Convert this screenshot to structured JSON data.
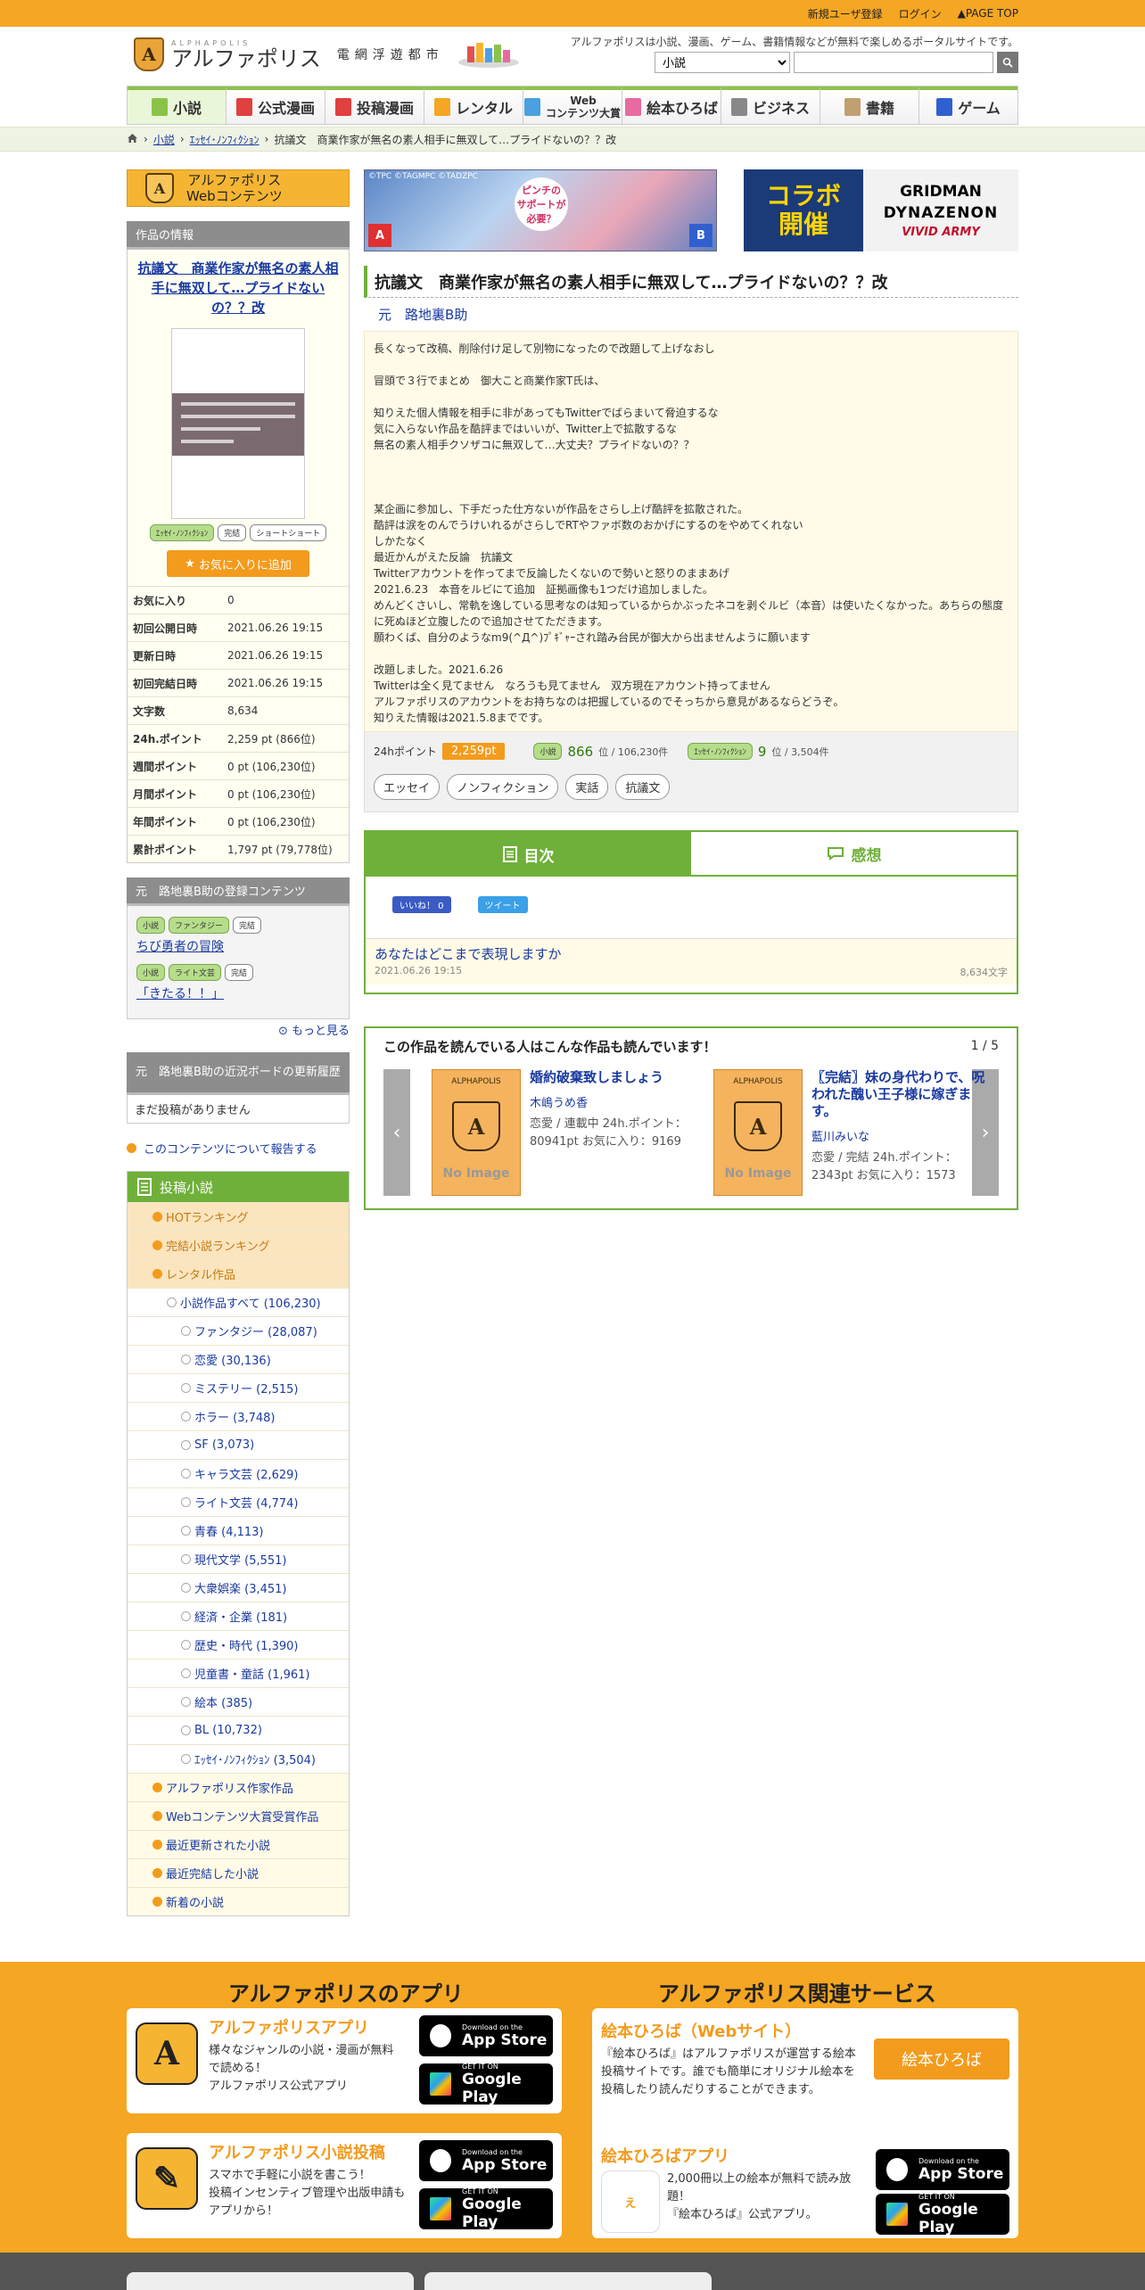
{
  "topbar": {
    "register": "新規ユーザ登録",
    "login": "ログイン",
    "pagetop": "PAGE TOP"
  },
  "header": {
    "logo_small": "ALPHAPOLIS",
    "logo_main": "アルファポリス",
    "logo_sub": "電網浮遊都市",
    "tagline": "アルファポリスは小説、漫画、ゲーム、書籍情報などが無料で楽しめるポータルサイトです。",
    "search_category": "小説"
  },
  "nav": [
    {
      "label": "小説",
      "color": "#8bc34a"
    },
    {
      "label": "公式漫画",
      "color": "#e04040"
    },
    {
      "label": "投稿漫画",
      "color": "#e04040"
    },
    {
      "label": "レンタル",
      "color": "#f5a623"
    },
    {
      "label": "Web\nコンテンツ大賞",
      "color": "#4aa0e0"
    },
    {
      "label": "絵本ひろば",
      "color": "#e86aa0"
    },
    {
      "label": "ビジネス",
      "color": "#888888"
    },
    {
      "label": "書籍",
      "color": "#c0a070"
    },
    {
      "label": "ゲーム",
      "color": "#3060d0"
    }
  ],
  "breadcrumb": {
    "c1": "小説",
    "c2": "ｴｯｾｲ･ﾉﾝﾌｨｸｼｮﾝ",
    "c3": "抗議文　商業作家が無名の素人相手に無双して…プライドないの？？改"
  },
  "side": {
    "webcontents_line1": "アルファポリス",
    "webcontents_line2": "Webコンテンツ",
    "info_header": "作品の情報",
    "title": "抗議文　商業作家が無名の素人相手に無双して…プライドないの？？改",
    "tags": [
      "ｴｯｾｲ･ﾉﾝﾌｨｸｼｮﾝ",
      "完結",
      "ショートショート"
    ],
    "fav_button": "お気に入りに追加",
    "stats": [
      {
        "k": "お気に入り",
        "v": "0"
      },
      {
        "k": "初回公開日時",
        "v": "2021.06.26 19:15"
      },
      {
        "k": "更新日時",
        "v": "2021.06.26 19:15"
      },
      {
        "k": "初回完結日時",
        "v": "2021.06.26 19:15"
      },
      {
        "k": "文字数",
        "v": "8,634"
      },
      {
        "k": "24h.ポイント",
        "v": "2,259 pt (866位)"
      },
      {
        "k": "週間ポイント",
        "v": "0 pt (106,230位)"
      },
      {
        "k": "月間ポイント",
        "v": "0 pt (106,230位)"
      },
      {
        "k": "年間ポイント",
        "v": "0 pt (106,230位)"
      },
      {
        "k": "累計ポイント",
        "v": "1,797 pt (79,778位)"
      }
    ],
    "reg_header": "元　路地裏B助の登録コンテンツ",
    "reg_items": [
      {
        "tags": [
          "小説",
          "ファンタジー",
          "完結"
        ],
        "title": "ちび勇者の冒険"
      },
      {
        "tags": [
          "小説",
          "ライト文芸",
          "完結"
        ],
        "title": "「きたる！！」"
      }
    ],
    "more": "もっと見る",
    "board_header": "元　路地裏B助の近況ボードの更新履歴",
    "board_none": "まだ投稿がありません",
    "report": "このコンテンツについて報告する",
    "menu_header": "投稿小説",
    "menu": [
      {
        "label": "HOTランキング",
        "cls": "orange"
      },
      {
        "label": "完結小説ランキング",
        "cls": "orange"
      },
      {
        "label": "レンタル作品",
        "cls": "orange"
      },
      {
        "label": "小説作品すべて (106,230)",
        "cls": "sub"
      },
      {
        "label": "ファンタジー (28,087)",
        "cls": "sub2"
      },
      {
        "label": "恋愛 (30,136)",
        "cls": "sub2"
      },
      {
        "label": "ミステリー (2,515)",
        "cls": "sub2"
      },
      {
        "label": "ホラー (3,748)",
        "cls": "sub2"
      },
      {
        "label": "SF (3,073)",
        "cls": "sub2"
      },
      {
        "label": "キャラ文芸 (2,629)",
        "cls": "sub2"
      },
      {
        "label": "ライト文芸 (4,774)",
        "cls": "sub2"
      },
      {
        "label": "青春 (4,113)",
        "cls": "sub2"
      },
      {
        "label": "現代文学 (5,551)",
        "cls": "sub2"
      },
      {
        "label": "大衆娯楽 (3,451)",
        "cls": "sub2"
      },
      {
        "label": "経済・企業 (181)",
        "cls": "sub2"
      },
      {
        "label": "歴史・時代 (1,390)",
        "cls": "sub2"
      },
      {
        "label": "児童書・童話 (1,961)",
        "cls": "sub2"
      },
      {
        "label": "絵本 (385)",
        "cls": "sub2"
      },
      {
        "label": "BL (10,732)",
        "cls": "sub2"
      },
      {
        "label": "ｴｯｾｲ･ﾉﾝﾌｨｸｼｮﾝ (3,504)",
        "cls": "sub2"
      },
      {
        "label": "アルファポリス作家作品",
        "cls": "yl"
      },
      {
        "label": "Webコンテンツ大賞受賞作品",
        "cls": "yl"
      },
      {
        "label": "最近更新された小説",
        "cls": "yl"
      },
      {
        "label": "最近完結した小説",
        "cls": "yl"
      },
      {
        "label": "新着の小説",
        "cls": "yl"
      }
    ]
  },
  "banner": {
    "copy": "©TPC ©TAGMPC ©TADZPC",
    "bubble": "ピンチの\nサポートが\n必要？",
    "collab": "コラボ\n開催",
    "g1": "GRIDMAN",
    "g2": "DYNAZENON",
    "g3": "VIVID ARMY"
  },
  "work": {
    "title": "抗議文　商業作家が無名の素人相手に無双して…プライドないの？？改",
    "author": "元　路地裏B助",
    "description": "長くなって改稿、削除付け足して別物になったので改題して上げなおし\n\n冒頭で３行でまとめ　御大こと商業作家T氏は、\n\n知りえた個人情報を相手に非があってもTwitterでばらまいて脅迫するな\n気に入らない作品を酷評まではいいが、Twitter上で拡散するな\n無名の素人相手クソザコに無双して…大丈夫？プライドないの？？\n\n\n\n某企画に参加し、下手だった仕方ないが作品をさらし上げ酷評を拡散された。\n酷評は涙をのんでうけいれるがさらしでRTやファボ数のおかげにするのをやめてくれない\nしかたなく\n最近かんがえた反論　抗議文\nTwitterアカウントを作ってまで反論したくないので勢いと怒りのままあげ\n2021.6.23　本音をルビにて追加　証拠画像も1つだけ追加しました。\nめんどくさいし、常軌を逸している思考なのは知っているからかぶったネコを剥ぐルビ（本音）は使いたくなかった。あちらの態度に死ぬほど立腹したので追加させてただきます。\n願わくば、自分のようなm9(^Д^)ﾌﾟｷﾞｬｰされ踏み台民が御大から出ませんように願います\n\n改題しました。2021.6.26\nTwitterは全く見てません　なろうも見てません　双方現在アカウント持ってません\nアルファポリスのアカウントをお持ちなのは把握しているのでそっちから意見があるならどうぞ。\n知りえた情報は2021.5.8までです。",
    "points_label": "24hポイント",
    "points_value": "2,259pt",
    "rank1_tag": "小説",
    "rank1_value": "866",
    "rank1_rest": "位 / 106,230件",
    "rank2_tag": "ｴｯｾｲ･ﾉﾝﾌｨｸｼｮﾝ",
    "rank2_value": "9",
    "rank2_rest": "位 / 3,504件",
    "tags": [
      "エッセイ",
      "ノンフィクション",
      "実話",
      "抗議文"
    ]
  },
  "tabs": {
    "toc": "目次",
    "review": "感想",
    "like": "いいね！ 0",
    "tweet": "ツイート"
  },
  "episode": {
    "title": "あなたはどこまで表現しますか",
    "date": "2021.06.26 19:15",
    "length": "8,634文字"
  },
  "reco": {
    "header": "この作品を読んでいる人はこんな作品も読んでいます！",
    "page": "1 / 5",
    "noimg_label": "ALPHAPOLIS",
    "noimg_text": "No Image",
    "cards": [
      {
        "title": "婚約破棄致しましょう",
        "author": "木嶋うめ香",
        "meta": "恋愛 / 連載中 24h.ポイント：80941pt お気に入り：9169"
      },
      {
        "title": "〖完結〗妹の身代わりで、呪われた醜い王子様に嫁ぎます。",
        "author": "藍川みいな",
        "meta": "恋愛 / 完結 24h.ポイント：2343pt お気に入り：1573"
      }
    ]
  },
  "footer": {
    "apps_h": "アルファポリスのアプリ",
    "services_h": "アルファポリス関連サービス",
    "app1_title": "アルファポリスアプリ",
    "app1_text": "様々なジャンルの小説・漫画が無料で読める！\nアルファポリス公式アプリ",
    "app2_title": "アルファポリス小説投稿",
    "app2_text": "スマホで手軽に小説を書こう！\n投稿インセンティブ管理や出版申請もアプリから！",
    "ehon_title": "絵本ひろば（Webサイト）",
    "ehon_text": "『絵本ひろば』はアルファポリスが運営する絵本投稿サイトです。誰でも簡単にオリジナル絵本を投稿したり読んだりすることができます。",
    "ehon_button": "絵本ひろば",
    "ehonapp_title": "絵本ひろばアプリ",
    "ehonapp_text": "2,000冊以上の絵本が無料で読み放題！\n『絵本ひろば』公式アプリ。",
    "appstore_1": "Download on the",
    "appstore_2": "App Store",
    "gplay_1": "GET IT ON",
    "gplay_2": "Google Play"
  }
}
